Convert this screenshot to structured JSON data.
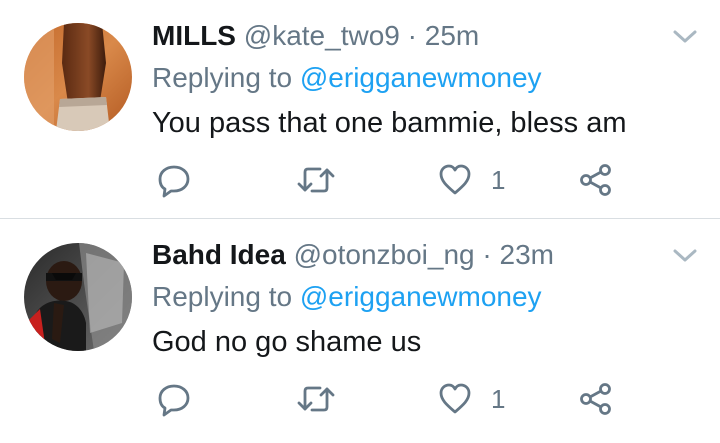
{
  "tweets": [
    {
      "display_name": "MILLS",
      "handle": "@kate_two9",
      "separator": "·",
      "time": "25m",
      "replying_prefix": "Replying to",
      "replying_to": "@erigganewmoney",
      "text": "You pass that one bammie, bless am",
      "like_count": "1"
    },
    {
      "display_name": "Bahd Idea",
      "handle": "@otonzboi_ng",
      "separator": "·",
      "time": "23m",
      "replying_prefix": "Replying to",
      "replying_to": "@erigganewmoney",
      "text": "God no go shame us",
      "like_count": "1"
    }
  ],
  "icons": {
    "reply": "reply-icon",
    "retweet": "retweet-icon",
    "like": "heart-icon",
    "share": "share-icon",
    "menu": "chevron-down-icon"
  },
  "colors": {
    "link": "#1da1f2",
    "secondary_text": "#657786",
    "primary_text": "#14171a",
    "divider": "#d9dee2"
  }
}
